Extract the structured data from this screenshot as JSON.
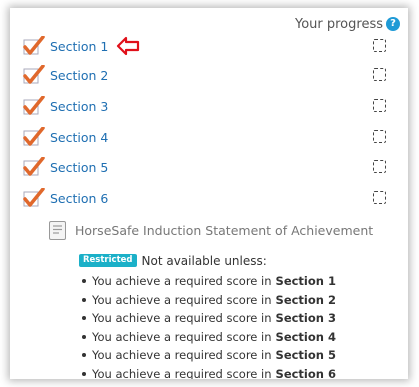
{
  "header": {
    "progress_label": "Your progress",
    "help_icon": "question-circle-icon",
    "help_glyph": "?"
  },
  "sections": [
    {
      "label": "Section 1"
    },
    {
      "label": "Section 2"
    },
    {
      "label": "Section 3"
    },
    {
      "label": "Section 4"
    },
    {
      "label": "Section 5"
    },
    {
      "label": "Section 6"
    }
  ],
  "activity": {
    "name": "HorseSafe Induction Statement of Achievement",
    "icon": "document-icon",
    "restriction": {
      "badge": "Restricted",
      "text": "Not available unless:",
      "conditions": [
        {
          "text": "You achieve a required score in",
          "section": "Section 1"
        },
        {
          "text": "You achieve a required score in",
          "section": "Section 2"
        },
        {
          "text": "You achieve a required score in",
          "section": "Section 3"
        },
        {
          "text": "You achieve a required score in",
          "section": "Section 4"
        },
        {
          "text": "You achieve a required score in",
          "section": "Section 5"
        },
        {
          "text": "You achieve a required score in",
          "section": "Section 6"
        }
      ]
    }
  },
  "colors": {
    "link": "#1f6fb2",
    "check": "#e0682c",
    "arrow": "#e0101a",
    "badge": "#1bb0c8",
    "help": "#1f9ad6"
  }
}
